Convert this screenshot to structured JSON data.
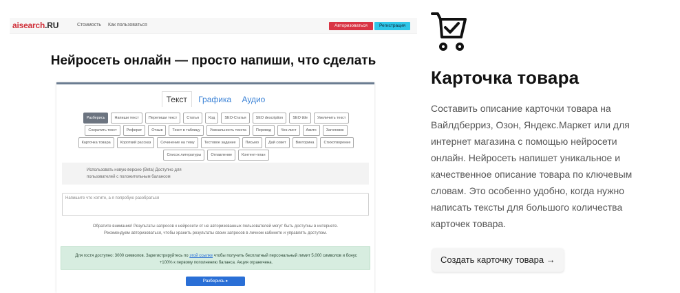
{
  "screenshot": {
    "nav": {
      "logo_main": "aisearch",
      "logo_suffix": ".RU",
      "links": [
        "Стоимость",
        "Как пользоваться"
      ],
      "login_label": "Авторизоваться",
      "register_label": "Регистрация"
    },
    "hero_title": "Нейросеть онлайн — просто напиши, что сделать",
    "tabs": [
      "Текст",
      "Графика",
      "Аудио"
    ],
    "active_tab": "Текст",
    "chips": [
      "Разберись",
      "Напиши текст",
      "Перепиши текст",
      "Статья",
      "Код",
      "SEO-Статья",
      "SEO description",
      "SEO title",
      "Увеличить текст",
      "Сократить текст",
      "Реферат",
      "Отзыв",
      "Текст в таблицу",
      "Уникальность текста",
      "Перевод",
      "Чек-лист",
      "Авито",
      "Заголовок",
      "Карточка товара",
      "Короткий рассказ",
      "Сочинение на тему",
      "Тестовое задание",
      "Письмо",
      "Дай совет",
      "Викторина",
      "Стихотворение",
      "Список литературы",
      "Оглавление",
      "Контент-план"
    ],
    "info_line1": "Использовать новую версию (Beta) Доступно для",
    "info_line2": "пользователей с положительным балансом",
    "textarea_placeholder": "Напишите что хотите, а я попробую разобраться",
    "warning_line1": "Обратите внимание! Результаты запросов к нейросети от не авторизованных пользователей могут быть доступны в интернете.",
    "warning_line2": "Рекомендуем авторизоваться, чтобы хранить результаты своих запросов в личном кабинете и управлять доступом.",
    "guest_pre": "Для гостя доступно: 3000 символов. Зарегистрируйтесь по ",
    "guest_link": "этой ссылке",
    "guest_post": " чтобы получить бесплатный персональный лимит 5,000 символов и бонус +100% к первому пополнению баланса. Акция ограничена.",
    "submit_label": "Разберись ▸"
  },
  "feature": {
    "icon": "shopping-cart-check-icon",
    "title": "Карточка товара",
    "description": "Составить описание карточки товара на Вайлдберриз, Озон, Яндекс.Маркет или для интернет магазина с помощью нейросети онлайн. Нейросеть напишет уникальное и качественное описание товара по ключевым словам. Это особенно удобно, когда нужно написать тексты для большого количества карточек товара.",
    "cta_label": "Создать карточку товара →"
  },
  "colors": {
    "logo": "#d0303a",
    "login_button": "#d93444",
    "register_button": "#2ec6e8",
    "primary": "#2a6fd6",
    "success_bg": "#d7ede0"
  }
}
